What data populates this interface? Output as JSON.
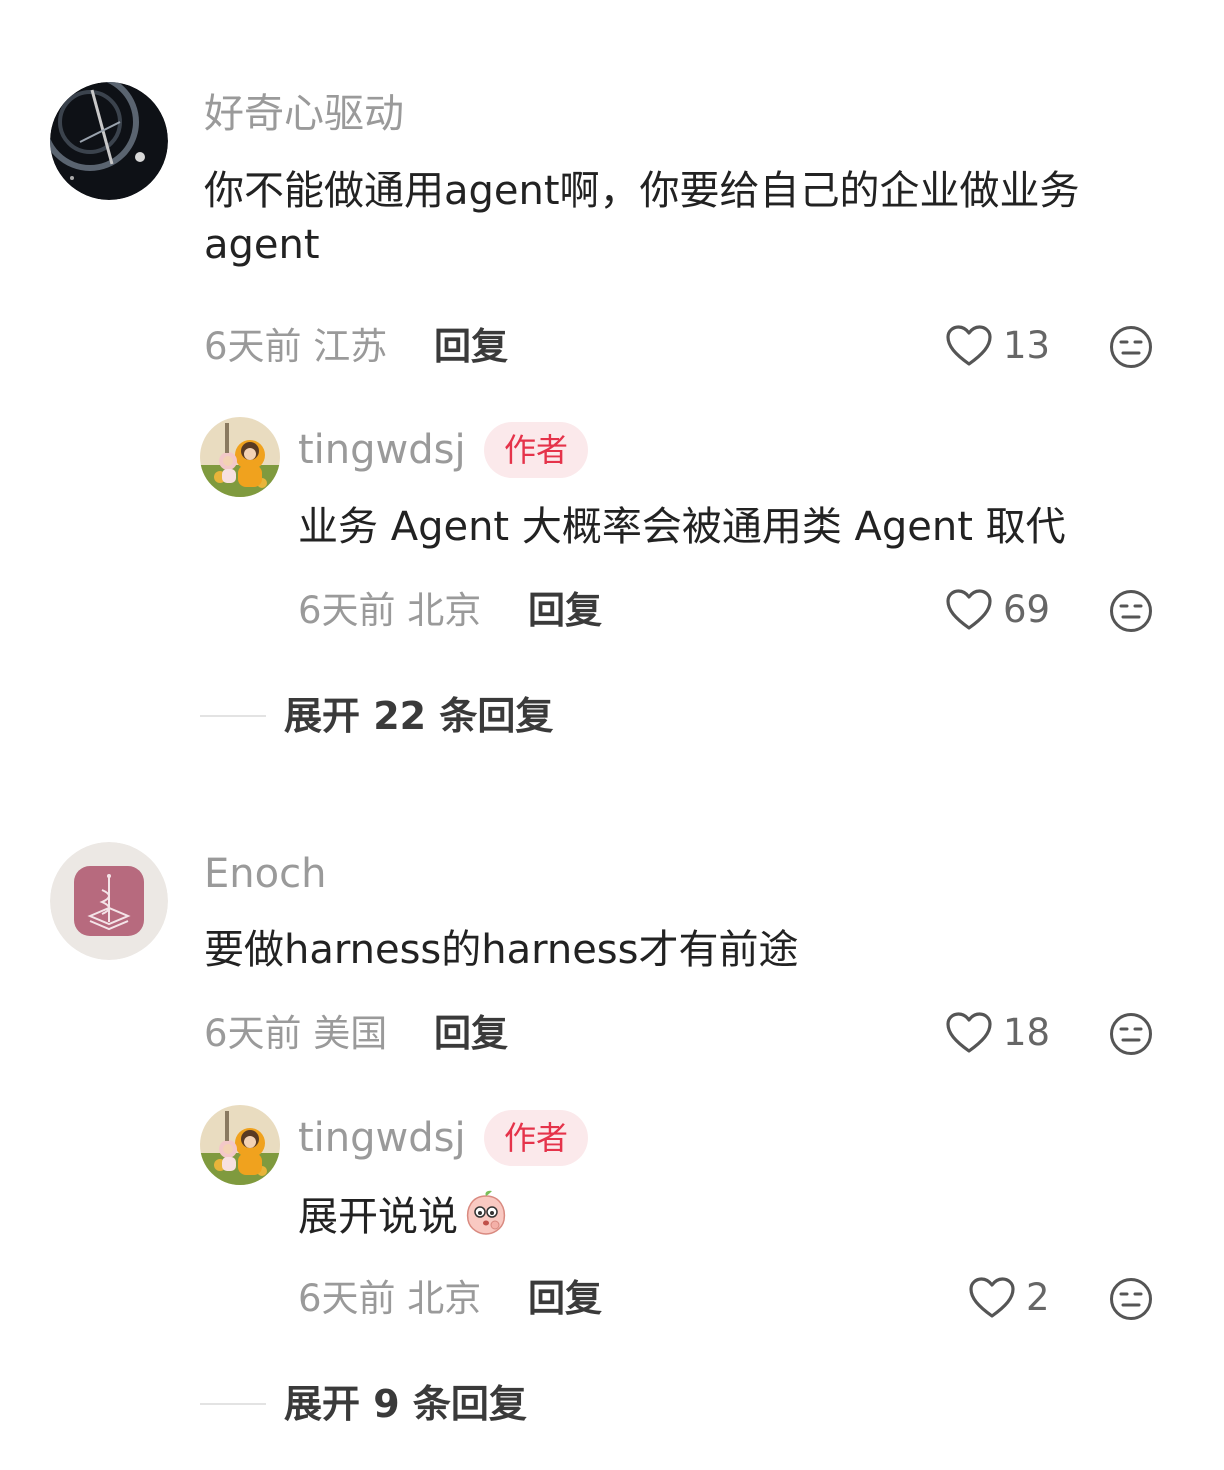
{
  "comments": [
    {
      "user": "好奇心驱动",
      "text": "你不能做通用agent啊，你要给自己的企业做业务agent",
      "meta": "6天前 江苏",
      "reply_label": "回复",
      "likes": "13",
      "avatar_icon": "space-station-avatar",
      "replies": [
        {
          "user": "tingwdsj",
          "badge": "作者",
          "text": "业务 Agent 大概率会被通用类 Agent 取代",
          "meta": "6天前 北京",
          "reply_label": "回复",
          "likes": "69",
          "avatar_icon": "illustrated-girls-avatar"
        }
      ],
      "expand_label": "展开 22 条回复"
    },
    {
      "user": "Enoch",
      "text": "要做harness的harness才有前途",
      "meta": "6天前 美国",
      "reply_label": "回复",
      "likes": "18",
      "avatar_icon": "pink-app-icon-avatar",
      "replies": [
        {
          "user": "tingwdsj",
          "badge": "作者",
          "text": "展开说说",
          "emoji": "peach-thinking-emoji",
          "meta": "6天前 北京",
          "reply_label": "回复",
          "likes": "2",
          "avatar_icon": "illustrated-girls-avatar"
        }
      ],
      "expand_label": "展开 9 条回复"
    }
  ],
  "colors": {
    "author_badge_text": "#e5334a",
    "author_badge_bg": "#fbe9eb",
    "secondary_text": "#9a9a9a"
  }
}
